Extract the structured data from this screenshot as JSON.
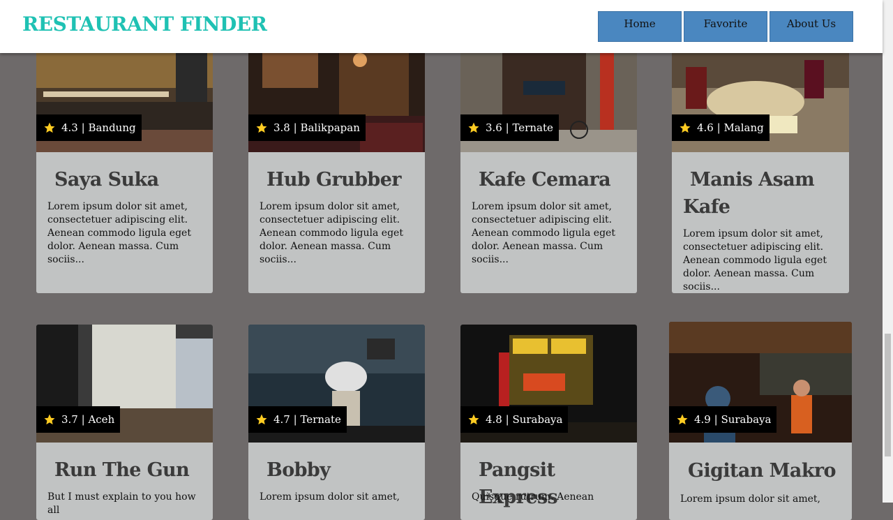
{
  "header": {
    "brand": "RESTAURANT FINDER",
    "nav": [
      "Home",
      "Favorite",
      "About Us"
    ]
  },
  "colors": {
    "brand": "#1fc1b3",
    "nav_button": "#4a87c0",
    "card_bg": "#c1c3c3",
    "page_bg": "#6e6a6a",
    "star": "#ffcc22"
  },
  "restaurants": [
    {
      "name": "Saya Suka",
      "rating": "4.3",
      "city": "Bandung",
      "desc": "Lorem ipsum dolor sit amet, consectetuer adipiscing elit. Aenean commodo ligula eget dolor. Aenean massa. Cum sociis..."
    },
    {
      "name": "Hub Grubber",
      "rating": "3.8",
      "city": "Balikpapan",
      "desc": "Lorem ipsum dolor sit amet, consectetuer adipiscing elit. Aenean commodo ligula eget dolor. Aenean massa. Cum sociis..."
    },
    {
      "name": "Kafe Cemara",
      "rating": "3.6",
      "city": "Ternate",
      "desc": "Lorem ipsum dolor sit amet, consectetuer adipiscing elit. Aenean commodo ligula eget dolor. Aenean massa. Cum sociis..."
    },
    {
      "name": "Manis Asam Kafe",
      "rating": "4.6",
      "city": "Malang",
      "desc": "Lorem ipsum dolor sit amet, consectetuer adipiscing elit. Aenean commodo ligula eget dolor. Aenean massa. Cum sociis..."
    },
    {
      "name": "Run The Gun",
      "rating": "3.7",
      "city": "Aceh",
      "desc": "But I must explain to you how all"
    },
    {
      "name": "Bobby",
      "rating": "4.7",
      "city": "Ternate",
      "desc": "Lorem ipsum dolor sit amet,"
    },
    {
      "name": "Pangsit Express",
      "rating": "4.8",
      "city": "Surabaya",
      "desc": "Quisque rutrum. Aenean"
    },
    {
      "name": "Gigitan Makro",
      "rating": "4.9",
      "city": "Surabaya",
      "desc": "Lorem ipsum dolor sit amet,"
    }
  ]
}
